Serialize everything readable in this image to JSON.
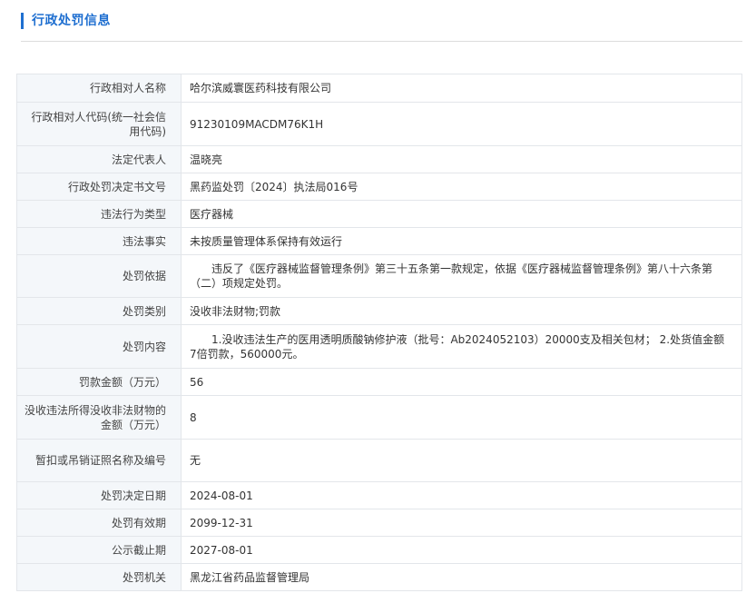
{
  "section": {
    "title": "行政处罚信息"
  },
  "rows": [
    {
      "label": "行政相对人名称",
      "value": "哈尔滨威寰医药科技有限公司"
    },
    {
      "label": "行政相对人代码(统一社会信用代码)",
      "value": "91230109MACDM76K1H"
    },
    {
      "label": "法定代表人",
      "value": "温晓亮"
    },
    {
      "label": "行政处罚决定书文号",
      "value": "黑药监处罚〔2024〕执法局016号"
    },
    {
      "label": "违法行为类型",
      "value": "医疗器械"
    },
    {
      "label": "违法事实",
      "value": "未按质量管理体系保持有效运行"
    },
    {
      "label": "处罚依据",
      "value": "违反了《医疗器械监督管理条例》第三十五条第一款规定，依据《医疗器械监督管理条例》第八十六条第（二）项规定处罚。"
    },
    {
      "label": "处罚类别",
      "value": "没收非法财物;罚款"
    },
    {
      "label": "处罚内容",
      "value": "1.没收违法生产的医用透明质酸钠修护液（批号：Ab2024052103）20000支及相关包材； 2.处货值金额7倍罚款，560000元。"
    },
    {
      "label": "罚款金额（万元）",
      "value": "56"
    },
    {
      "label": "没收违法所得没收非法财物的金额（万元）",
      "value": "8"
    },
    {
      "label": "暂扣或吊销证照名称及编号",
      "value": "无"
    },
    {
      "label": "处罚决定日期",
      "value": "2024-08-01"
    },
    {
      "label": "处罚有效期",
      "value": "2099-12-31"
    },
    {
      "label": "公示截止期",
      "value": "2027-08-01"
    },
    {
      "label": "处罚机关",
      "value": "黑龙江省药品监督管理局"
    }
  ]
}
